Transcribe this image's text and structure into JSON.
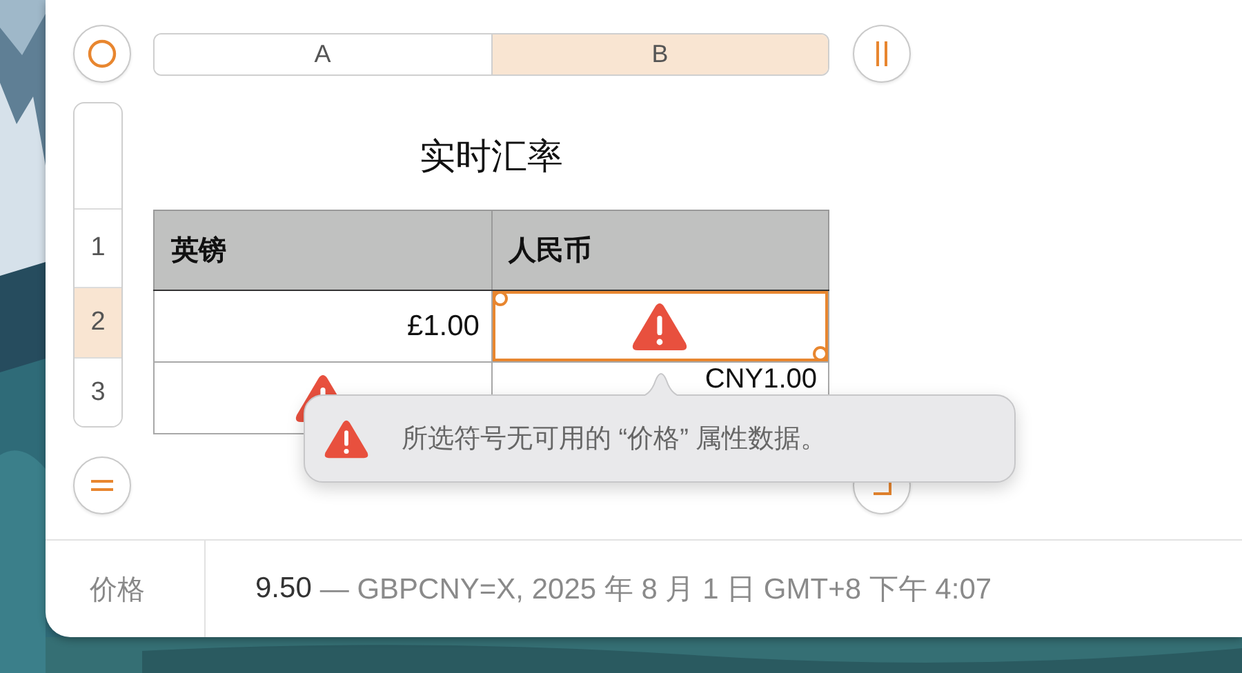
{
  "column_headers": [
    {
      "label": "A",
      "selected": false
    },
    {
      "label": "B",
      "selected": true
    }
  ],
  "row_headers": [
    {
      "label": "1",
      "selected": false
    },
    {
      "label": "2",
      "selected": true
    },
    {
      "label": "3",
      "selected": false
    }
  ],
  "table": {
    "title": "实时汇率",
    "columns": [
      "英镑",
      "人民币"
    ],
    "rows": [
      [
        {
          "kind": "text",
          "text": "£1.00",
          "selected": false
        },
        {
          "kind": "error",
          "selected": true
        }
      ],
      [
        {
          "kind": "error",
          "selected": false
        },
        {
          "kind": "text",
          "text": "CNY1.00",
          "selected": false
        }
      ]
    ]
  },
  "popover": {
    "message": "所选符号无可用的 “价格” 属性数据。"
  },
  "footer": {
    "label": "价格",
    "value": "9.50",
    "details": "— GBPCNY=X, 2025 年 8 月 1 日 GMT+8 下午 4:07"
  }
}
